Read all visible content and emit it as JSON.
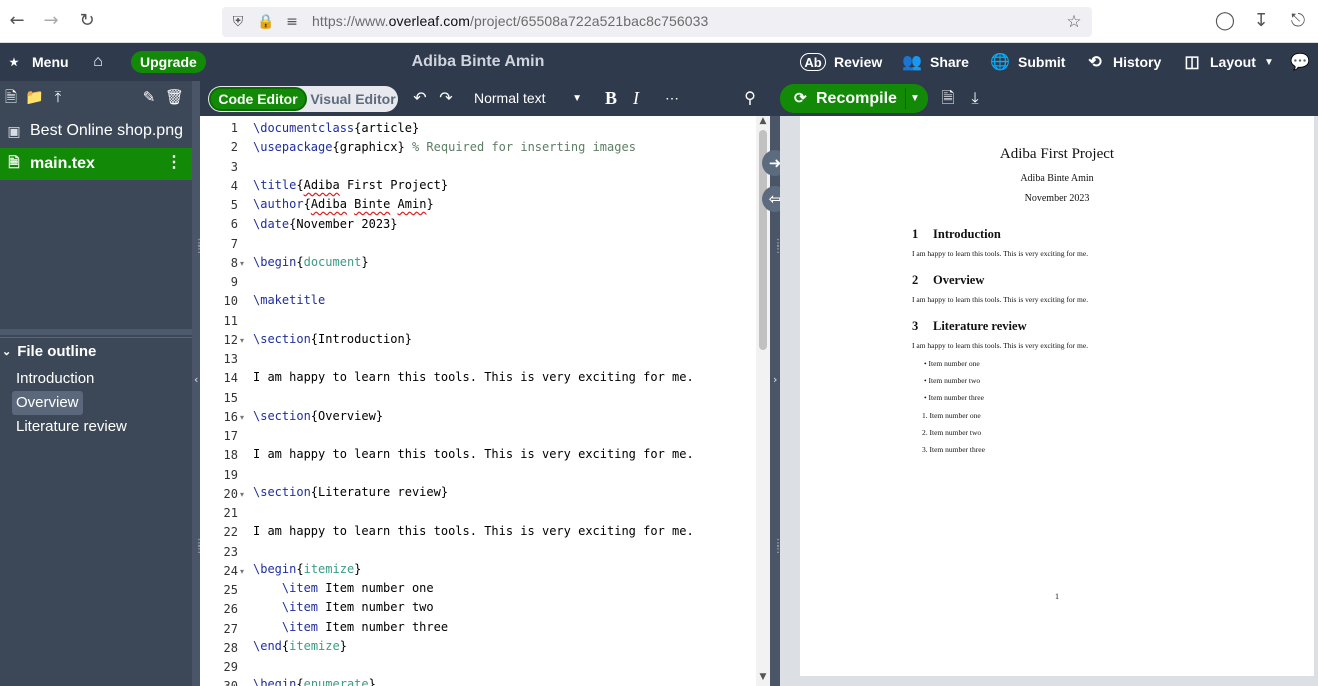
{
  "browser": {
    "url_prefix": "https://www.",
    "url_domain": "overleaf.com",
    "url_path": "/project/65508a722a521bac8c756033"
  },
  "topbar": {
    "menu": "Menu",
    "upgrade": "Upgrade",
    "project_title": "Adiba Binte Amin",
    "review": "Review",
    "share": "Share",
    "submit": "Submit",
    "history": "History",
    "layout": "Layout"
  },
  "files": [
    {
      "name": "Best Online shop.png",
      "icon": "image-icon",
      "selected": false
    },
    {
      "name": "main.tex",
      "icon": "file-icon",
      "selected": true
    }
  ],
  "outline": {
    "title": "File outline",
    "items": [
      "Introduction",
      "Overview",
      "Literature review"
    ],
    "highlighted": "Overview"
  },
  "editor_toolbar": {
    "code_editor": "Code Editor",
    "visual_editor": "Visual Editor",
    "text_style": "Normal text"
  },
  "editor": {
    "lines": [
      "1",
      "2",
      "3",
      "4",
      "5",
      "6",
      "7",
      "8",
      "9",
      "10",
      "11",
      "12",
      "13",
      "14",
      "15",
      "16",
      "17",
      "18",
      "19",
      "20",
      "21",
      "22",
      "23",
      "24",
      "25",
      "26",
      "27",
      "28",
      "29",
      "30"
    ],
    "code": {
      "l1_cmd": "\\documentclass",
      "l1_arg": "{article}",
      "l2_cmd": "\\usepackage",
      "l2_arg": "{graphicx}",
      "l2_comment": "% Required for inserting images",
      "l4_cmd": "\\title",
      "l4_a": "{",
      "l4_b": "Adiba",
      "l4_c": " First Project}",
      "l5_cmd": "\\author",
      "l5_a": "{",
      "l5_b": "Adiba",
      "l5_c": " ",
      "l5_d": "Binte",
      "l5_e": " ",
      "l5_f": "Amin",
      "l5_g": "}",
      "l6_cmd": "\\date",
      "l6_arg": "{November 2023}",
      "l8_cmd": "\\begin",
      "l8_a": "{",
      "l8_env": "document",
      "l8_b": "}",
      "l10_cmd": "\\maketitle",
      "l12_cmd": "\\section",
      "l12_arg": "{Introduction}",
      "l14_text": "I am happy to learn this tools. This is very exciting for me.",
      "l16_cmd": "\\section",
      "l16_arg": "{Overview}",
      "l18_text": "I am happy to learn this tools. This is very exciting for me.",
      "l20_cmd": "\\section",
      "l20_arg": "{Literature review}",
      "l22_text": "I am happy to learn this tools. This is very exciting for me.",
      "l24_cmd": "\\begin",
      "l24_a": "{",
      "l24_env": "itemize",
      "l24_b": "}",
      "l25_cmd": "\\item",
      "l25_text": " Item number one",
      "l26_cmd": "\\item",
      "l26_text": " Item number two",
      "l27_cmd": "\\item",
      "l27_text": " Item number three",
      "l28_cmd": "\\end",
      "l28_a": "{",
      "l28_env": "itemize",
      "l28_b": "}",
      "l30_cmd": "\\begin",
      "l30_a": "{",
      "l30_env": "enumerate",
      "l30_b": "}"
    }
  },
  "pdf_toolbar": {
    "recompile": "Recompile"
  },
  "pdf": {
    "title": "Adiba First Project",
    "author": "Adiba Binte Amin",
    "date": "November 2023",
    "sections": [
      {
        "num": "1",
        "title": "Introduction",
        "text": "I am happy to learn this tools. This is very exciting for me."
      },
      {
        "num": "2",
        "title": "Overview",
        "text": "I am happy to learn this tools. This is very exciting for me."
      },
      {
        "num": "3",
        "title": "Literature review",
        "text": "I am happy to learn this tools. This is very exciting for me."
      }
    ],
    "bullets": [
      "Item number one",
      "Item number two",
      "Item number three"
    ],
    "enum": [
      "1.",
      "2.",
      "3."
    ],
    "enum_items": [
      "Item number one",
      "Item number two",
      "Item number three"
    ],
    "page_number": "1"
  }
}
